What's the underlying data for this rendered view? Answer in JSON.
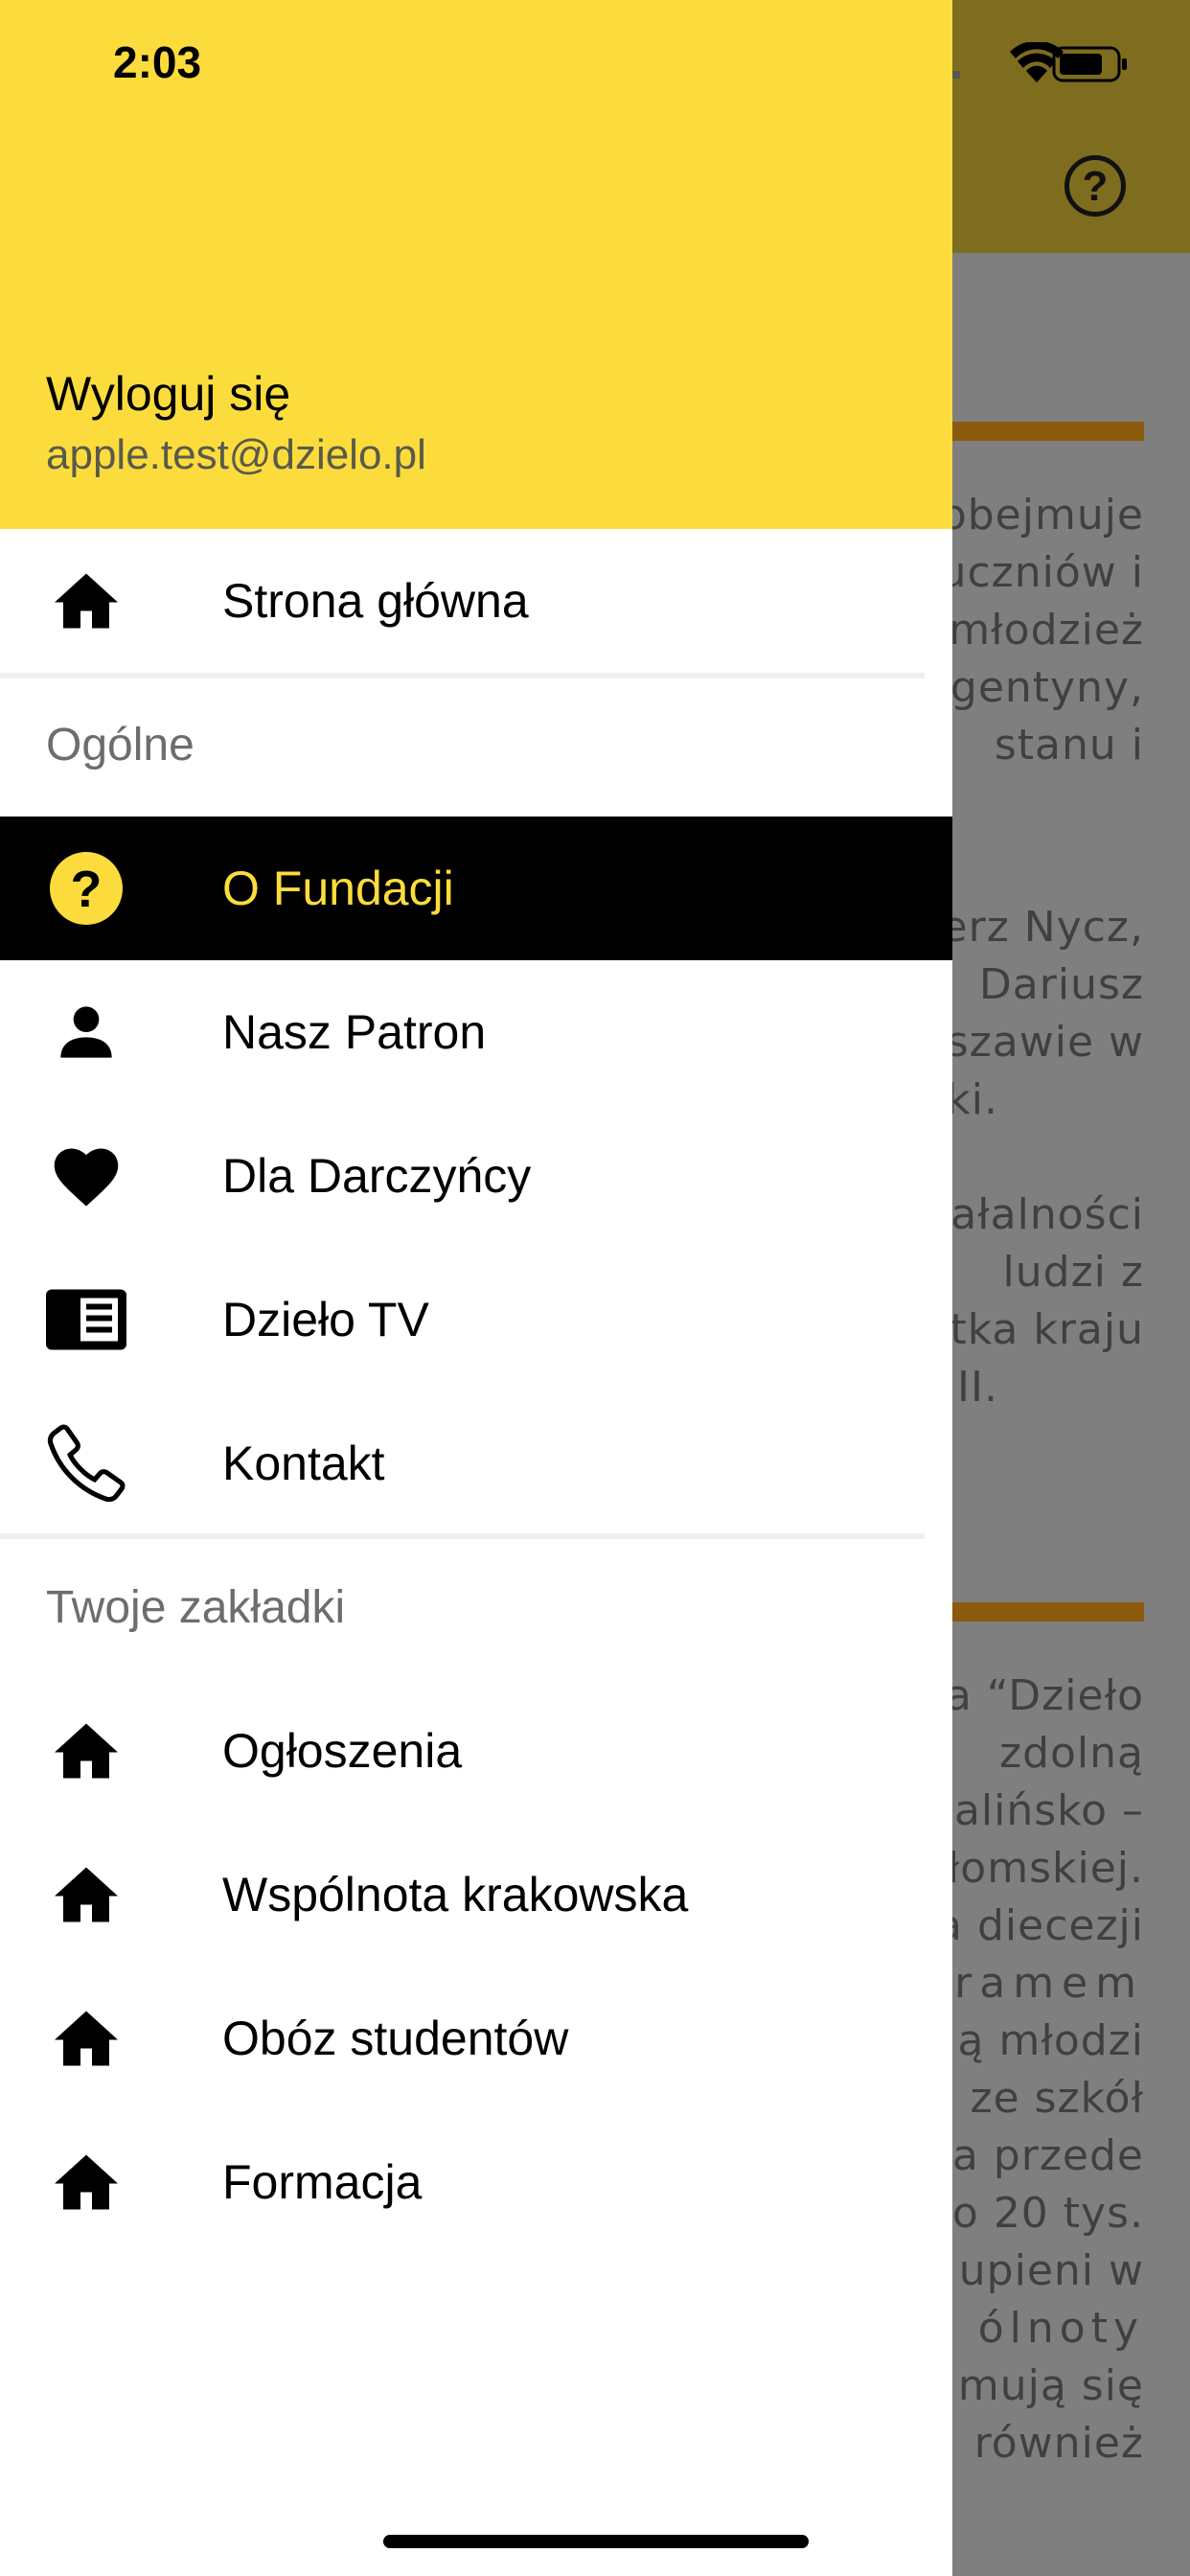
{
  "status_bar": {
    "time": "2:03"
  },
  "user": {
    "logout_label": "Wyloguj się",
    "email": "apple.test@dzielo.pl"
  },
  "menu": {
    "home": {
      "label": "Strona główna",
      "icon": "home-icon"
    },
    "general_section": "Ogólne",
    "general_items": [
      {
        "label": "O Fundacji",
        "icon": "help-circle-icon",
        "active": true
      },
      {
        "label": "Nasz Patron",
        "icon": "person-icon"
      },
      {
        "label": "Dla Darczyńcy",
        "icon": "heart-icon"
      },
      {
        "label": "Dzieło TV",
        "icon": "news-icon"
      },
      {
        "label": "Kontakt",
        "icon": "phone-icon"
      }
    ],
    "bookmarks_section": "Twoje zakładki",
    "bookmark_items": [
      {
        "label": "Ogłoszenia",
        "icon": "home-icon"
      },
      {
        "label": "Wspólnota krakowska",
        "icon": "home-icon"
      },
      {
        "label": "Obóz studentów",
        "icon": "home-icon"
      },
      {
        "label": "Formacja",
        "icon": "home-icon"
      }
    ]
  },
  "background_content": {
    "paragraph1": [
      "obejmuje",
      "uczniów i",
      "młodzież",
      "gentyny,",
      "stanu i"
    ],
    "paragraph2": [
      "erz Nycz,",
      "Dariusz",
      "szawie w",
      "ki."
    ],
    "paragraph3": [
      "ałalności",
      "ludzi z",
      "tka kraju",
      "II."
    ],
    "paragraph4": [
      "a “Dzieło",
      "zdolną",
      "alińsko –",
      "łomskiej.",
      "a diecezji",
      "ramem",
      "ą młodzi",
      "ze szkół",
      "a przede",
      "o 20 tys.",
      "upieni w",
      "ólnoty",
      "mują się",
      "również"
    ]
  },
  "colors": {
    "accent": "#fcdc3d",
    "active_bg": "#000000",
    "overlay": "#7f7f7f"
  }
}
